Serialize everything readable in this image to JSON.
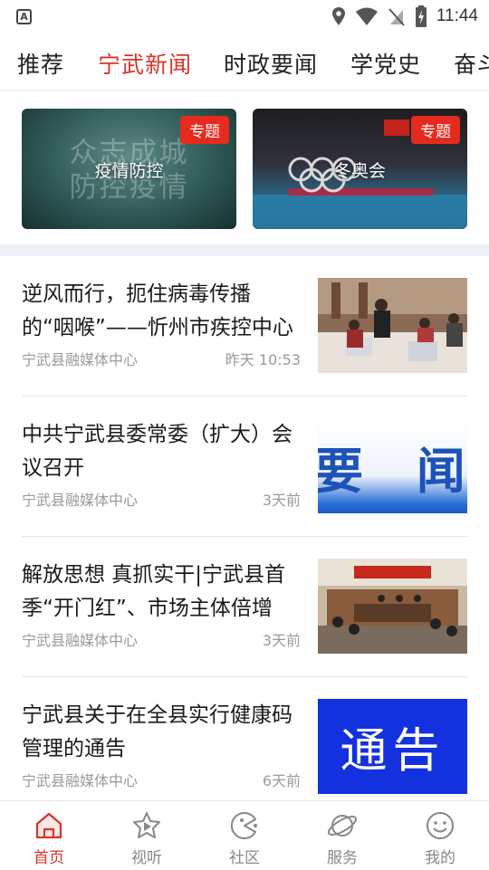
{
  "status_bar": {
    "app_indicator": "A",
    "time": "11:44"
  },
  "tabs": [
    {
      "label": "推荐"
    },
    {
      "label": "宁武新闻"
    },
    {
      "label": "时政要闻"
    },
    {
      "label": "学党史"
    },
    {
      "label": "奋斗"
    }
  ],
  "topics": [
    {
      "title": "疫情防控",
      "badge": "专题",
      "bg_text_line1": "众志成城",
      "bg_text_line2": "防控疫情"
    },
    {
      "title": "冬奥会",
      "badge": "专题"
    }
  ],
  "news": [
    {
      "title": "逆风而行，扼住病毒传播的“咽喉”——忻州市疾控中心",
      "source": "宁武县融媒体中心",
      "time": "昨天 10:53"
    },
    {
      "title": "中共宁武县委常委（扩大）会议召开",
      "source": "宁武县融媒体中心",
      "time": "3天前",
      "thumb_text": "要 闻"
    },
    {
      "title": "解放思想 真抓实干|宁武县首季“开门红”、市场主体倍增",
      "source": "宁武县融媒体中心",
      "time": "3天前"
    },
    {
      "title": "宁武县关于在全县实行健康码管理的通告",
      "source": "宁武县融媒体中心",
      "time": "6天前",
      "thumb_text": "通告"
    }
  ],
  "bottom_nav": [
    {
      "label": "首页",
      "icon": "home-icon",
      "active": true
    },
    {
      "label": "视听",
      "icon": "video-icon",
      "active": false
    },
    {
      "label": "社区",
      "icon": "community-icon",
      "active": false
    },
    {
      "label": "服务",
      "icon": "service-icon",
      "active": false
    },
    {
      "label": "我的",
      "icon": "profile-icon",
      "active": false
    }
  ],
  "colors": {
    "accent": "#d9342b",
    "badge": "#e52b1f",
    "notice_blue": "#1431e0"
  }
}
